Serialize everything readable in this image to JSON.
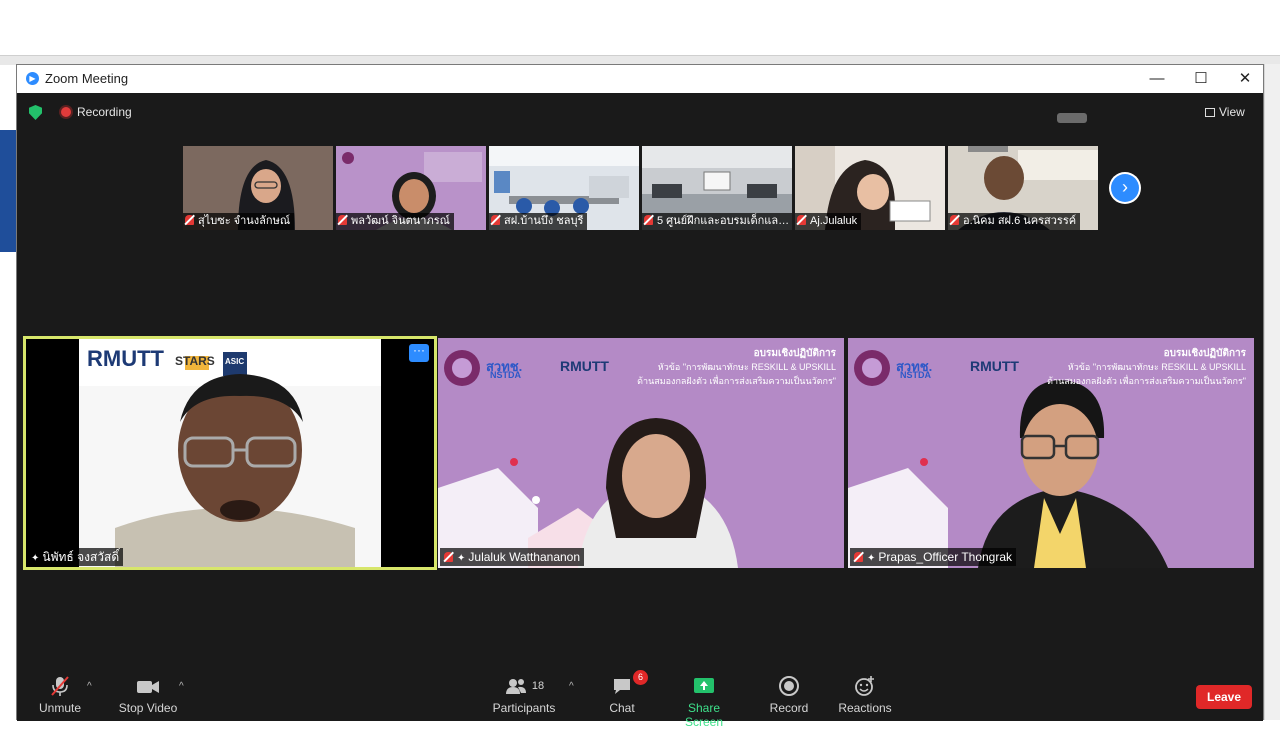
{
  "window": {
    "title": "Zoom Meeting",
    "minimize": "—",
    "maximize": "☐",
    "close": "✕"
  },
  "topbar": {
    "recording": "Recording",
    "view": "View"
  },
  "thumbnails": [
    {
      "name": "สุไบซะ จำนงลักษณ์"
    },
    {
      "name": "พลวัฒน์ จินตนาภรณ์"
    },
    {
      "name": "สฝ.บ้านบึง ชลบุรี"
    },
    {
      "name": "5 ศูนย์ฝึกและอบรมเด็กและ..."
    },
    {
      "name": "Aj.Julaluk"
    },
    {
      "name": "อ.นิคม สฝ.6 นครสวรรค์"
    }
  ],
  "tiles": [
    {
      "name": "นิพัทธ์ จงสวัสดิ์",
      "logos": {
        "brand": "RMUTT",
        "stars": "STARS",
        "asic": "ASIC"
      }
    },
    {
      "name": "Julaluk Watthananon",
      "slide": {
        "org1": "สวทช.",
        "org2": "NSTDA",
        "brand": "RMUTT",
        "heading": "อบรมเชิงปฏิบัติการ",
        "topic": "หัวข้อ \"การพัฒนาทักษะ RESKILL & UPSKILL",
        "topic2": "ด้านสมองกลฝังตัว เพื่อการส่งเสริมความเป็นนวัตกร\""
      }
    },
    {
      "name": "Prapas_Officer Thongrak",
      "slide": {
        "org1": "สวทช.",
        "org2": "NSTDA",
        "brand": "RMUTT",
        "heading": "อบรมเชิงปฏิบัติการ",
        "topic": "หัวข้อ \"การพัฒนาทักษะ RESKILL & UPSKILL",
        "topic2": "ด้านสมองกลฝังตัว เพื่อการส่งเสริมความเป็นนวัตกร\""
      }
    }
  ],
  "toolbar": {
    "unmute": "Unmute",
    "stop_video": "Stop Video",
    "participants": "Participants",
    "participants_count": "18",
    "chat": "Chat",
    "chat_badge": "6",
    "share_screen": "Share Screen",
    "record": "Record",
    "reactions": "Reactions",
    "leave": "Leave"
  },
  "colors": {
    "accent": "#2d8cff",
    "share": "#23c16b",
    "leave": "#e02828",
    "active_speaker": "#d7e66b",
    "slide": "#b48ac6"
  }
}
